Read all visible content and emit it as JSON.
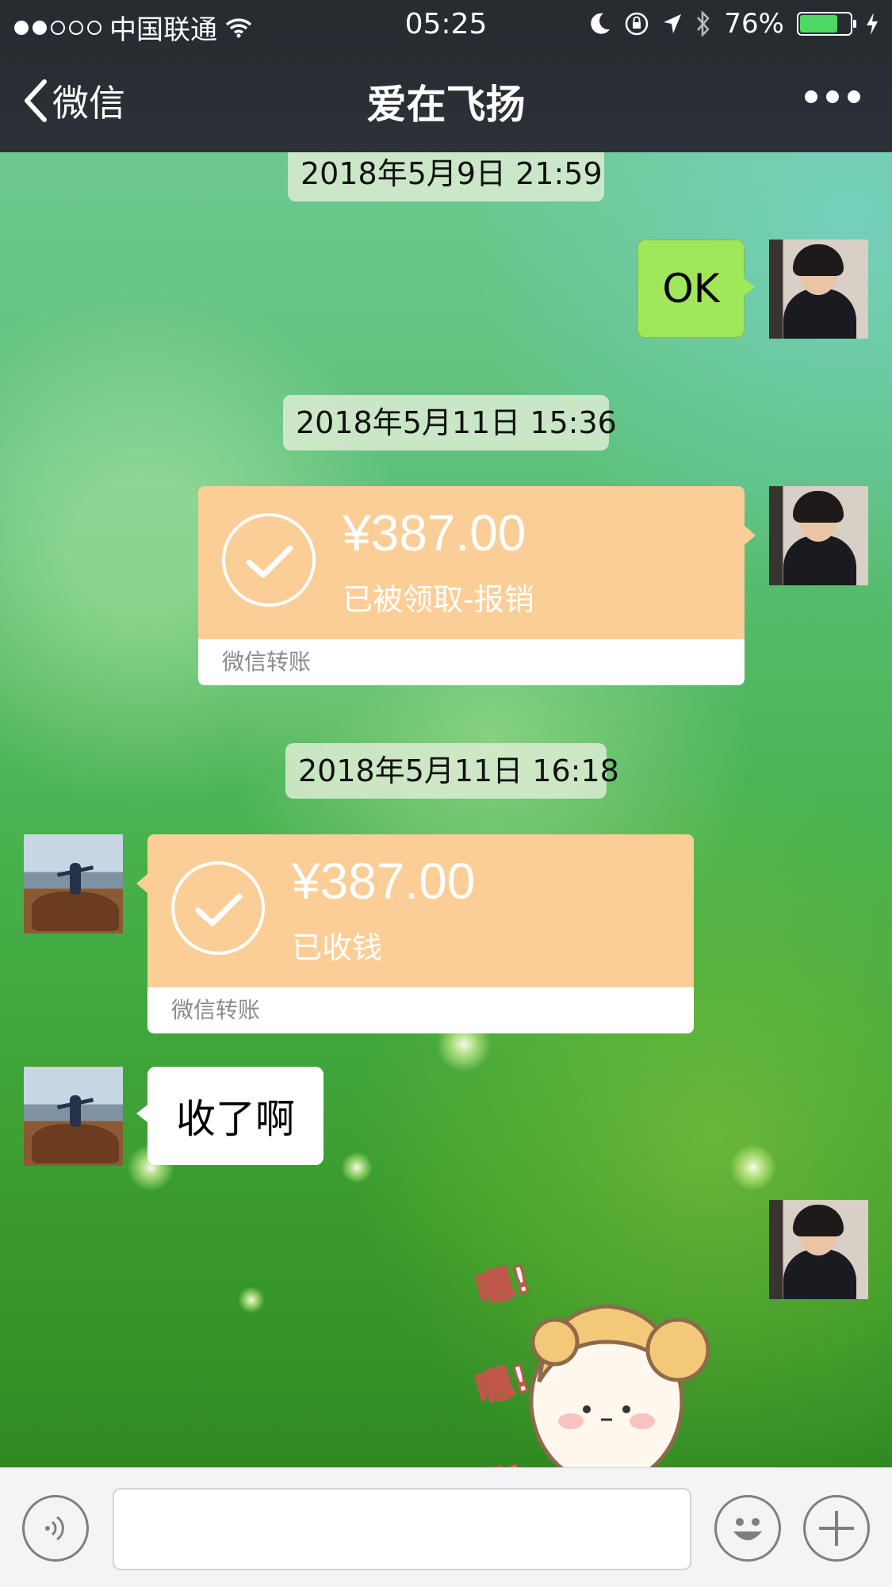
{
  "status_bar": {
    "carrier": "中国联通",
    "signal_dots_filled": 2,
    "signal_dots_total": 5,
    "time": "05:25",
    "battery_percent": "76%",
    "battery_level": 0.76
  },
  "nav": {
    "back_label": "微信",
    "title": "爱在飞扬"
  },
  "messages": {
    "time1": "2018年5月9日 21:59",
    "ok_text": "OK",
    "time2": "2018年5月11日 15:36",
    "transfer1": {
      "amount": "¥387.00",
      "status": "已被领取-报销",
      "footer": "微信转账"
    },
    "time3": "2018年5月11日 16:18",
    "transfer2": {
      "amount": "¥387.00",
      "status": "已收钱",
      "footer": "微信转账"
    },
    "received_text": "收了啊",
    "sticker_text": [
      "嗯!",
      "嗯!",
      "嗯!"
    ]
  },
  "colors": {
    "transfer_orange": "#fcce97",
    "my_bubble": "#a0e75a",
    "nav_bg": "#2b3137"
  }
}
